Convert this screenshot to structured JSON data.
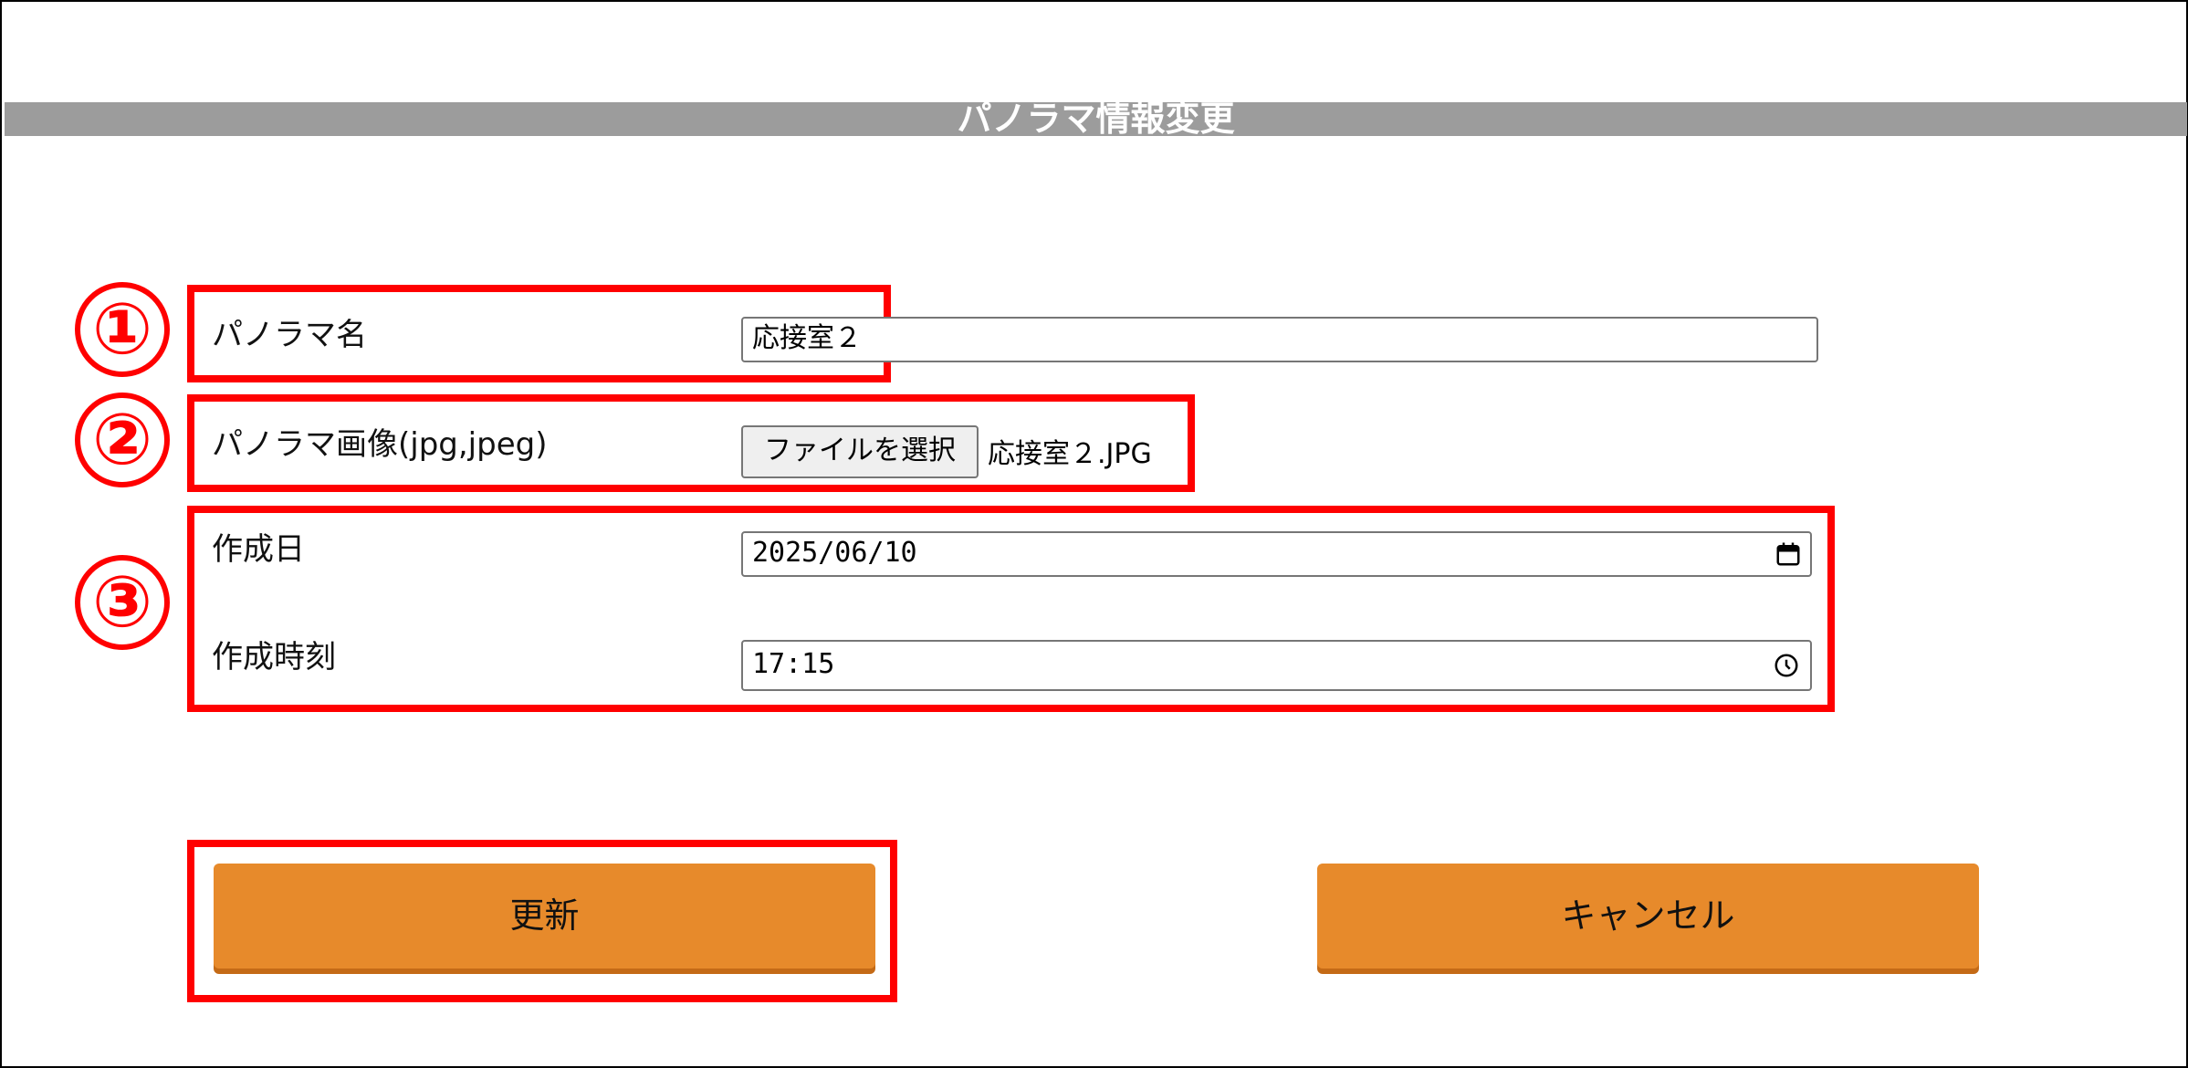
{
  "dialog": {
    "title": "パノラマ情報変更"
  },
  "markers": [
    "①",
    "②",
    "③"
  ],
  "fields": {
    "name": {
      "label": "パノラマ名",
      "value": "応接室２"
    },
    "image": {
      "label": "パノラマ画像(jpg,jpeg)",
      "button_label": "ファイルを選択",
      "file_name": "応接室２.JPG"
    },
    "date": {
      "label": "作成日",
      "value": "2025/06/10"
    },
    "time": {
      "label": "作成時刻",
      "value": "17:15"
    }
  },
  "actions": {
    "update_label": "更新",
    "cancel_label": "キャンセル"
  },
  "colors": {
    "highlight": "#ff0000",
    "button": "#e78a2b",
    "header": "#9c9c9c"
  },
  "icons": {
    "date_picker": "calendar-icon",
    "time_picker": "clock-icon"
  }
}
